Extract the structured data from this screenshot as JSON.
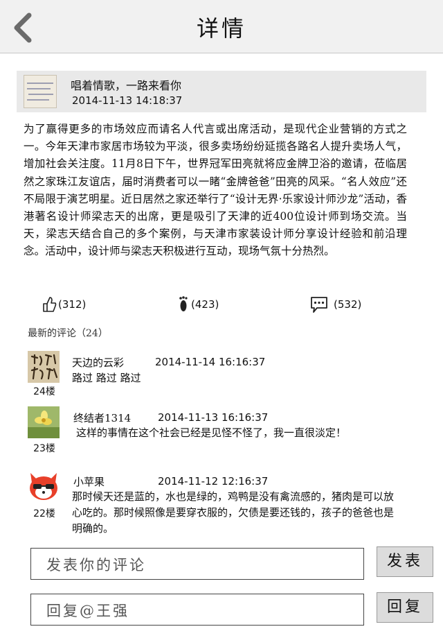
{
  "nav": {
    "title": "详情",
    "back_icon": "chevron-left-icon"
  },
  "post": {
    "author": "唱着情歌，一路来看你",
    "time": "2014-11-13  14:18:37",
    "body": "为了赢得更多的市场效应而请名人代言或出席活动，是现代企业营销的方式之一。今年天津市家居市场较为平淡，很多卖场纷纷延揽各路名人提升卖场人气，增加社会关注度。11月8日下午，世界冠军田亮就将应金牌卫浴的邀请，莅临居然之家珠江友谊店，届时消费者可以一睹“金牌爸爸”田亮的风采。“名人效应”还不局限于演艺明星。近日居然之家还举行了“设计无界·乐家设计师沙龙”活动，香港著名设计师梁志天的出席，更是吸引了天津的近400位设计师到场交流。当天，梁志天结合自己的多个案例，与天津市家装设计师分享设计经验和前沿理念。活动中，设计师与梁志天积极进行互动，现场气氛十分热烈。"
  },
  "stats": {
    "likes": "(312)",
    "footprints": "(423)",
    "comments": "(532)",
    "like_icon": "thumbs-up-icon",
    "footprint_icon": "footprint-icon",
    "comment_icon": "comment-bubble-icon"
  },
  "comments_heading": "最新的评论（24）",
  "comments": [
    {
      "user": "天边的云彩",
      "time": "2014-11-14  16:16:37",
      "text": "路过 路过 路过",
      "floor": "24楼"
    },
    {
      "user": "终结者1314",
      "time": "2014-11-13  16:16:37",
      "text": "这样的事情在这个社会已经是见怪不怪了，我一直很淡定！",
      "floor": "23楼"
    },
    {
      "user": "小苹果",
      "time": "2014-11-12  12:16:37",
      "text": "那时候天还是蓝的，水也是绿的，鸡鸭是没有禽流感的，猪肉是可以放心吃的。那时候照像是要穿衣服的，欠债是要还钱的，孩子的爸爸也是明确的。",
      "floor": "22楼"
    }
  ],
  "comment_input": {
    "placeholder": "发表你的评论",
    "button": "发表"
  },
  "reply_input": {
    "placeholder": "回复@王强",
    "button": "回复"
  }
}
